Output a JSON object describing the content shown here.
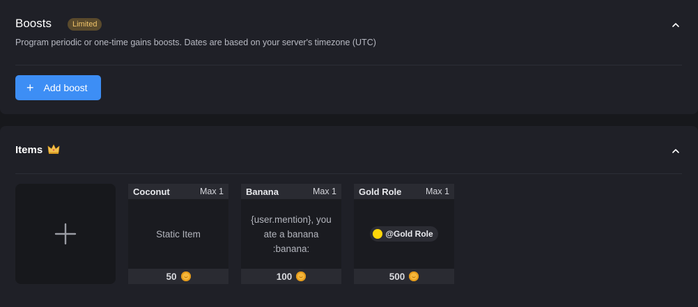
{
  "boosts": {
    "title": "Boosts",
    "badge": "Limited",
    "description": "Program periodic or one-time gains boosts. Dates are based on your server's timezone (UTC)",
    "add_button": "Add boost"
  },
  "items": {
    "title": "Items",
    "cards": [
      {
        "name": "Coconut",
        "max": "Max 1",
        "body": "Static Item",
        "price": "50"
      },
      {
        "name": "Banana",
        "max": "Max 1",
        "body": "{user.mention}, you ate a banana :banana:",
        "price": "100"
      },
      {
        "name": "Gold Role",
        "max": "Max 1",
        "role": "@Gold Role",
        "price": "500"
      }
    ]
  },
  "colors": {
    "background": "#17181c",
    "panel": "#1f2027",
    "accent": "#3d8ef5",
    "badge_bg": "#5a4a2c",
    "badge_text": "#f1c46a",
    "coin": "#f5b73b",
    "role_dot": "#ffd60a"
  },
  "icons": {
    "collapse": "chevron-up-icon",
    "add": "plus-icon",
    "crown": "crown-icon",
    "currency": "coin-icon"
  }
}
